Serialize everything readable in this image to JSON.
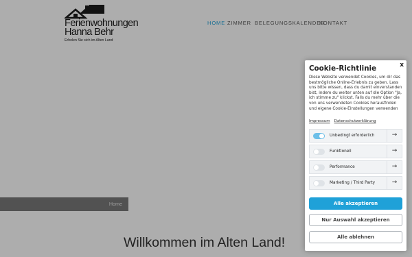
{
  "logo": {
    "line1": "Ferienwohnungen",
    "line2": "Hanna Behr",
    "tagline": "Erholen Sie sich im Alten Land",
    "icon": "house-roof-icon"
  },
  "nav": {
    "items": [
      {
        "label": "HOME",
        "active": true
      },
      {
        "label": "ZIMMER",
        "active": false
      },
      {
        "label": "BELEGUNGSKALENDER",
        "active": false
      },
      {
        "label": "KONTAKT",
        "active": false
      }
    ]
  },
  "breadcrumb": {
    "label": "Home"
  },
  "welcome": {
    "heading": "Willkommen im Alten Land!"
  },
  "cookie": {
    "close": "x",
    "title": "Cookie-Richtlinie",
    "description": "Diese Website verwendet Cookies, um dir das bestmögliche Online-Erlebnis zu geben. Lass uns bitte wissen, dass du damit einverstanden bist, indem du weiter unten auf die Option \"Ja, ich stimme zu\" klickst. Falls du mehr über die von uns verwendeten Cookies herausfinden und eigene Cookie-Einstellungen verwenden",
    "links": {
      "impressum": "Impressum",
      "datenschutz": "Datenschutzerklärung"
    },
    "categories": [
      {
        "label": "Unbedingt erforderlich",
        "enabled": true
      },
      {
        "label": "Funktionell",
        "enabled": false
      },
      {
        "label": "Performance",
        "enabled": false
      },
      {
        "label": "Marketing / Third Party",
        "enabled": false
      }
    ],
    "arrow": "→",
    "buttons": {
      "accept_all": "Alle akzeptieren",
      "accept_selection": "Nur Auswahl akzeptieren",
      "reject_all": "Alle ablehnen"
    }
  },
  "colors": {
    "accent": "#1fa1d8",
    "toggle_on": "#6dbfe8",
    "overlay": "rgba(0,0,0,0.32)"
  }
}
